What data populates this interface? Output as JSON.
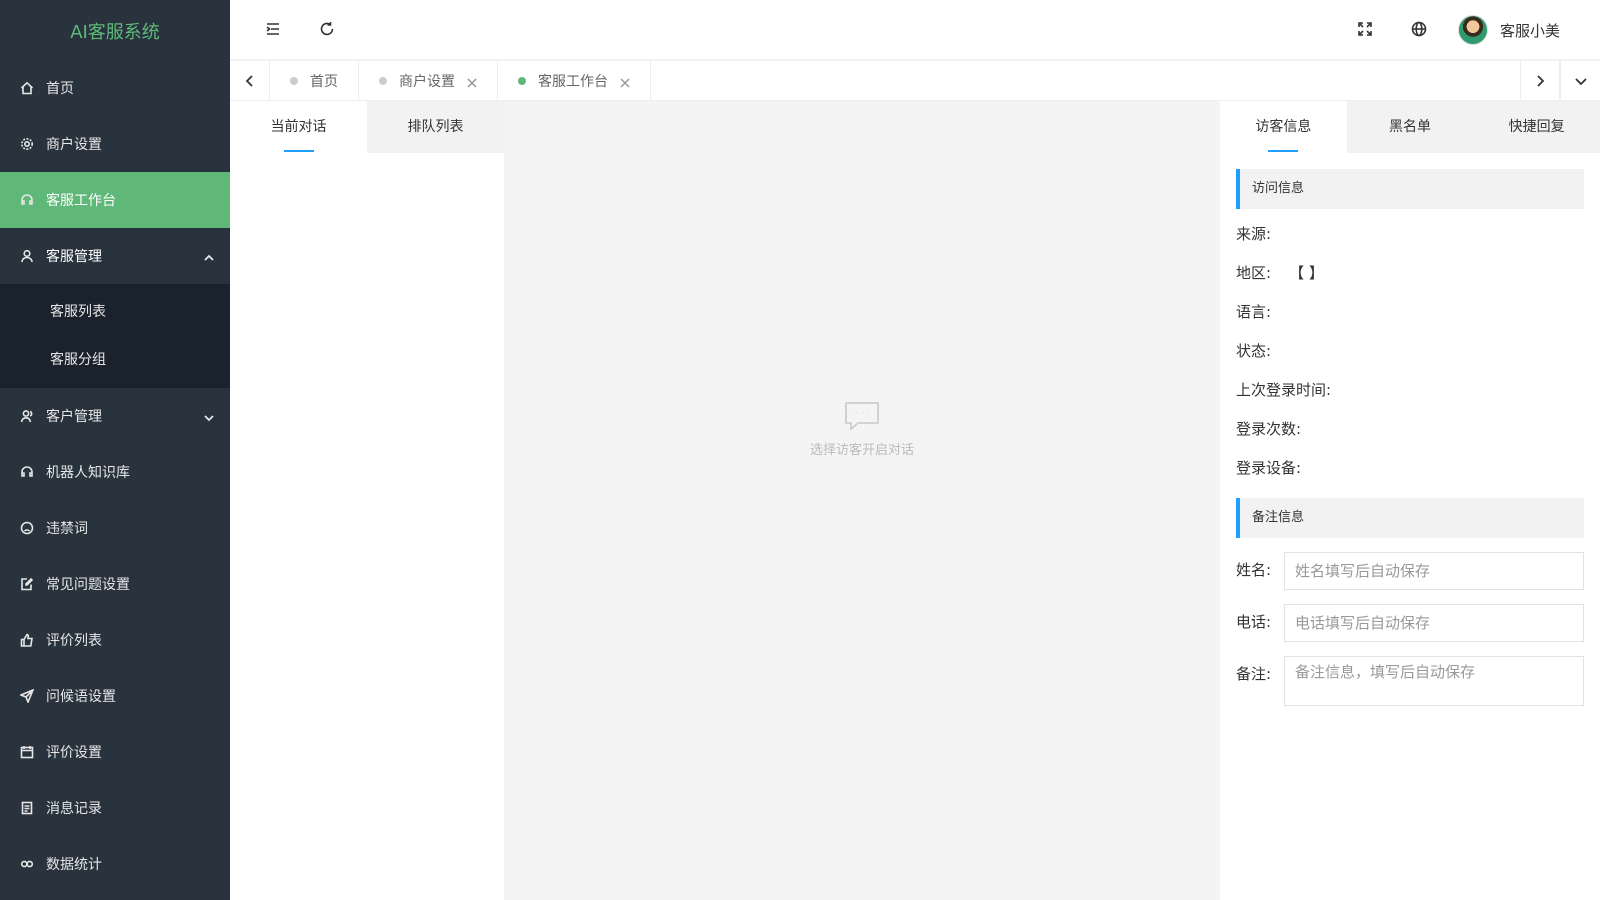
{
  "app": {
    "title": "AI客服系统"
  },
  "sidebar": {
    "items": [
      {
        "label": "首页",
        "icon": "home-icon"
      },
      {
        "label": "商户设置",
        "icon": "gear-icon"
      },
      {
        "label": "客服工作台",
        "icon": "headset-icon",
        "active": true
      },
      {
        "label": "客服管理",
        "icon": "user-icon",
        "expanded": true,
        "children": [
          {
            "label": "客服列表"
          },
          {
            "label": "客服分组"
          }
        ]
      },
      {
        "label": "客户管理",
        "icon": "users-icon"
      },
      {
        "label": "机器人知识库",
        "icon": "robot-icon"
      },
      {
        "label": "违禁词",
        "icon": "face-icon"
      },
      {
        "label": "常见问题设置",
        "icon": "edit-icon"
      },
      {
        "label": "评价列表",
        "icon": "thumbs-up-icon"
      },
      {
        "label": "问候语设置",
        "icon": "send-icon"
      },
      {
        "label": "评价设置",
        "icon": "calendar-icon"
      },
      {
        "label": "消息记录",
        "icon": "file-icon"
      },
      {
        "label": "数据统计",
        "icon": "link-icon"
      }
    ]
  },
  "header": {
    "username": "客服小美"
  },
  "tabs": [
    {
      "label": "首页",
      "closable": false
    },
    {
      "label": "商户设置",
      "closable": true
    },
    {
      "label": "客服工作台",
      "closable": true,
      "active": true
    }
  ],
  "conversation": {
    "tabs": [
      {
        "label": "当前对话"
      },
      {
        "label": "排队列表"
      }
    ]
  },
  "chat": {
    "empty_text": "选择访客开启对话"
  },
  "panel": {
    "tabs": [
      {
        "label": "访客信息"
      },
      {
        "label": "黑名单"
      },
      {
        "label": "快捷回复"
      }
    ],
    "visit_title": "访问信息",
    "fields": [
      {
        "label": "来源:",
        "value": ""
      },
      {
        "label": "地区:",
        "value": "【 】"
      },
      {
        "label": "语言:",
        "value": ""
      },
      {
        "label": "状态:",
        "value": ""
      },
      {
        "label": "上次登录时间:",
        "value": ""
      },
      {
        "label": "登录次数:",
        "value": ""
      },
      {
        "label": "登录设备:",
        "value": ""
      }
    ],
    "note_title": "备注信息",
    "form": {
      "name_label": "姓名:",
      "name_placeholder": "姓名填写后自动保存",
      "phone_label": "电话:",
      "phone_placeholder": "电话填写后自动保存",
      "note_label": "备注:",
      "note_placeholder": "备注信息，填写后自动保存"
    }
  },
  "colors": {
    "sidebar_bg": "#28333e",
    "accent_green": "#5fb878",
    "accent_blue": "#1e9fff"
  }
}
